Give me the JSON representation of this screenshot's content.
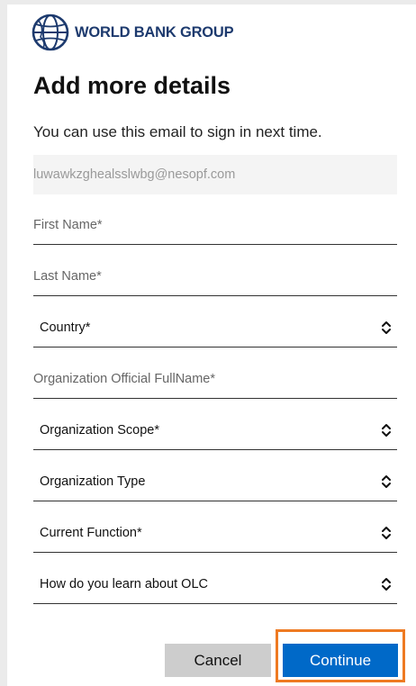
{
  "header": {
    "logo_text": "WORLD BANK GROUP",
    "logo_icon": "world-bank-globe-icon",
    "brand_color": "#1d3a6e"
  },
  "title": "Add more details",
  "subtitle": "You can use this email to sign in next time.",
  "email": {
    "value": "luwawkzghealsslwbg@nesopf.com"
  },
  "fields": {
    "first_name": {
      "placeholder": "First Name*"
    },
    "last_name": {
      "placeholder": "Last Name*"
    },
    "country": {
      "label": "Country*",
      "icon": "chevron-up-down-icon"
    },
    "org_name": {
      "placeholder": "Organization Official FullName*"
    },
    "org_scope": {
      "label": "Organization Scope*",
      "icon": "chevron-up-down-icon"
    },
    "org_type": {
      "label": "Organization Type",
      "icon": "chevron-up-down-icon"
    },
    "current_function": {
      "label": "Current Function*",
      "icon": "chevron-up-down-icon"
    },
    "learn_about": {
      "label": "How do you learn about OLC",
      "icon": "chevron-up-down-icon"
    }
  },
  "buttons": {
    "cancel": "Cancel",
    "continue": "Continue"
  },
  "colors": {
    "accent": "#0069c8",
    "highlight": "#ee7a22",
    "cancel_bg": "#cdcdcd"
  }
}
